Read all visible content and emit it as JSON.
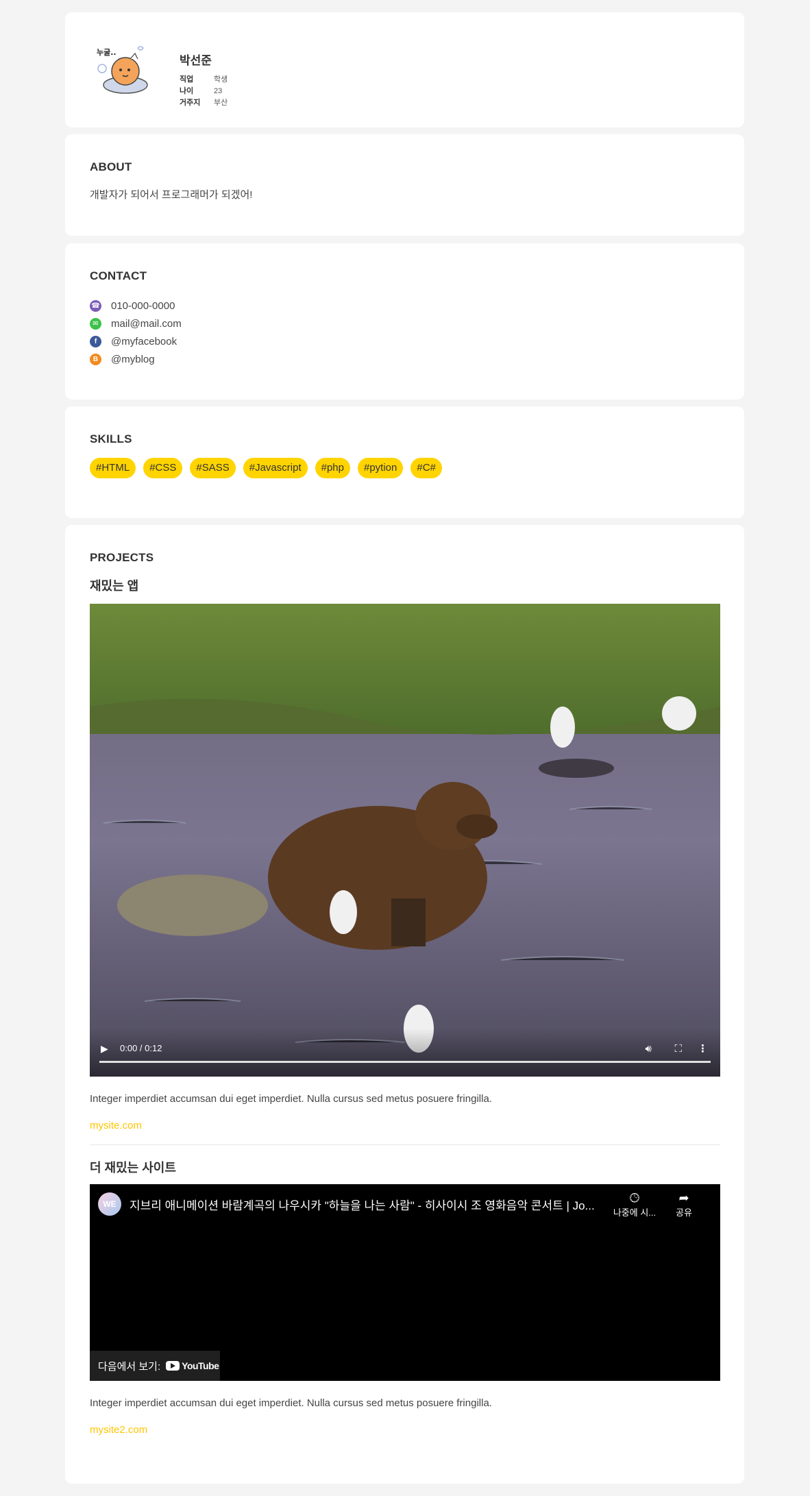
{
  "profile": {
    "name": "박선준",
    "avatar_caption": "누굴..",
    "info": [
      {
        "label": "직업",
        "value": "학생"
      },
      {
        "label": "나이",
        "value": "23"
      },
      {
        "label": "거주지",
        "value": "부산"
      }
    ]
  },
  "about": {
    "title": "ABOUT",
    "text": "개발자가 되어서 프로그래머가 되겠어!"
  },
  "contact": {
    "title": "CONTACT",
    "items": [
      {
        "icon": "phone-icon",
        "color": "#7b5cb8",
        "text": "010-000-0000"
      },
      {
        "icon": "mail-icon",
        "color": "#3cc24a",
        "text": "mail@mail.com"
      },
      {
        "icon": "facebook-icon",
        "color": "#3b5998",
        "text": "@myfacebook"
      },
      {
        "icon": "blogger-icon",
        "color": "#f28a1e",
        "text": "@myblog"
      }
    ]
  },
  "skills": {
    "title": "SKILLS",
    "tags": [
      "#HTML",
      "#CSS",
      "#SASS",
      "#Javascript",
      "#php",
      "#pytion",
      "#C#"
    ]
  },
  "projects": {
    "title": "PROJECTS",
    "items": [
      {
        "title": "재밌는 앱",
        "video_time": "0:00 / 0:12",
        "desc": "Integer imperdiet accumsan dui eget imperdiet. Nulla cursus sed metus posuere fringilla.",
        "link": "mysite.com"
      },
      {
        "title": "더 재밌는 사이트",
        "yt_channel": "WE",
        "yt_title": "지브리 애니메이션 바람계곡의 나우시카 \"하늘을 나는 사람\" - 히사이시 조 영화음악 콘서트 | Jo...",
        "yt_watch_later": "나중에 시...",
        "yt_share": "공유",
        "yt_watch_on": "다음에서 보기:",
        "yt_brand": "YouTube",
        "desc": "Integer imperdiet accumsan dui eget imperdiet. Nulla cursus sed metus posuere fringilla.",
        "link": "mysite2.com"
      }
    ]
  }
}
